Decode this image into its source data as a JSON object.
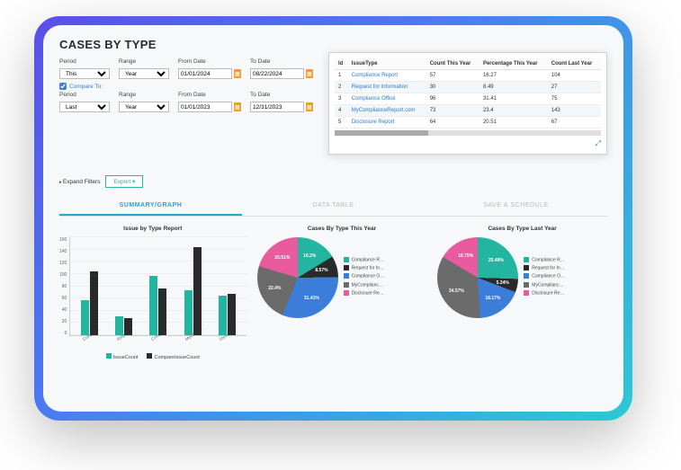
{
  "title": "CASES BY TYPE",
  "filters": {
    "period1_label": "Period",
    "period1_value": "This",
    "range1_label": "Range",
    "range1_value": "Year",
    "from1_label": "From Date",
    "from1_value": "01/01/2024",
    "to1_label": "To Date",
    "to1_value": "08/22/2024",
    "compare_label": "Compare To:",
    "period2_label": "Period",
    "period2_value": "Last",
    "range2_label": "Range",
    "range2_value": "Year",
    "from2_label": "From Date",
    "from2_value": "01/01/2023",
    "to2_label": "To Date",
    "to2_value": "12/31/2023"
  },
  "table": {
    "headers": {
      "id": "Id",
      "type": "IssueType",
      "count": "Count This Year",
      "pct": "Percentage This Year",
      "last": "Count Last Year"
    },
    "rows": [
      {
        "id": "1",
        "type": "Compliance Report",
        "count": "57",
        "pct": "16.27",
        "last": "104"
      },
      {
        "id": "2",
        "type": "Request for Information",
        "count": "30",
        "pct": "8.49",
        "last": "27"
      },
      {
        "id": "3",
        "type": "Compliance Office",
        "count": "96",
        "pct": "31.41",
        "last": "75"
      },
      {
        "id": "4",
        "type": "MyComplianceReport.com",
        "count": "73",
        "pct": "23.4",
        "last": "143"
      },
      {
        "id": "5",
        "type": "Disclosure Report",
        "count": "64",
        "pct": "20.51",
        "last": "67"
      }
    ]
  },
  "actions": {
    "expand_filters": "Expand Filters",
    "export": "Export  ▾"
  },
  "tabs": {
    "summary": "SUMMARY/GRAPH",
    "data": "DATA TABLE",
    "save": "SAVE & SCHEDULE"
  },
  "bar_chart": {
    "title": "Issue by Type Report",
    "legend1": "IssueCount",
    "legend2": "CompareIssueCount"
  },
  "pie1": {
    "title": "Cases By Type This Year"
  },
  "pie2": {
    "title": "Cases By Type Last Year"
  },
  "pie_legend": {
    "l1": "Compliance R…",
    "l2": "Request for In…",
    "l3": "Compliance O…",
    "l4": "MyComplianc…",
    "l5": "Disclosure Re…"
  },
  "chart_data": [
    {
      "type": "bar",
      "title": "Issue by Type Report",
      "categories": [
        "Compliance Report",
        "Request for Information",
        "Compliance Office",
        "MyComplianceReport.com",
        "Disclosure Report"
      ],
      "series": [
        {
          "name": "IssueCount",
          "values": [
            57,
            30,
            96,
            73,
            64
          ]
        },
        {
          "name": "CompareIssueCount",
          "values": [
            104,
            27,
            75,
            143,
            67
          ]
        }
      ],
      "ylim": [
        0,
        160
      ],
      "ticks": [
        0,
        20,
        40,
        60,
        80,
        100,
        120,
        140,
        160
      ]
    },
    {
      "type": "pie",
      "title": "Cases By Type This Year",
      "categories": [
        "Compliance Report",
        "Request for Information",
        "Compliance Office",
        "MyComplianceReport.com",
        "Disclosure Report"
      ],
      "values": [
        16.27,
        8.49,
        31.41,
        23.4,
        20.51
      ],
      "labels": [
        "16.2%",
        "8.57%",
        "31.41%",
        "22.4%",
        "20.51%"
      ]
    },
    {
      "type": "pie",
      "title": "Cases By Type Last Year",
      "categories": [
        "Compliance Report",
        "Request for Information",
        "Compliance Office",
        "MyComplianceReport.com",
        "Disclosure Report"
      ],
      "values": [
        25.49,
        5.34,
        18.17,
        34.57,
        16.75
      ],
      "labels": [
        "25.49%",
        "5.34%",
        "18.17%",
        "34.57%",
        "16.75%"
      ]
    }
  ],
  "colors": {
    "teal": "#24b5a0",
    "dark": "#2a2a2a",
    "blue": "#3b7dd8",
    "pink": "#e85b9e",
    "grey": "#6b6b6b"
  }
}
